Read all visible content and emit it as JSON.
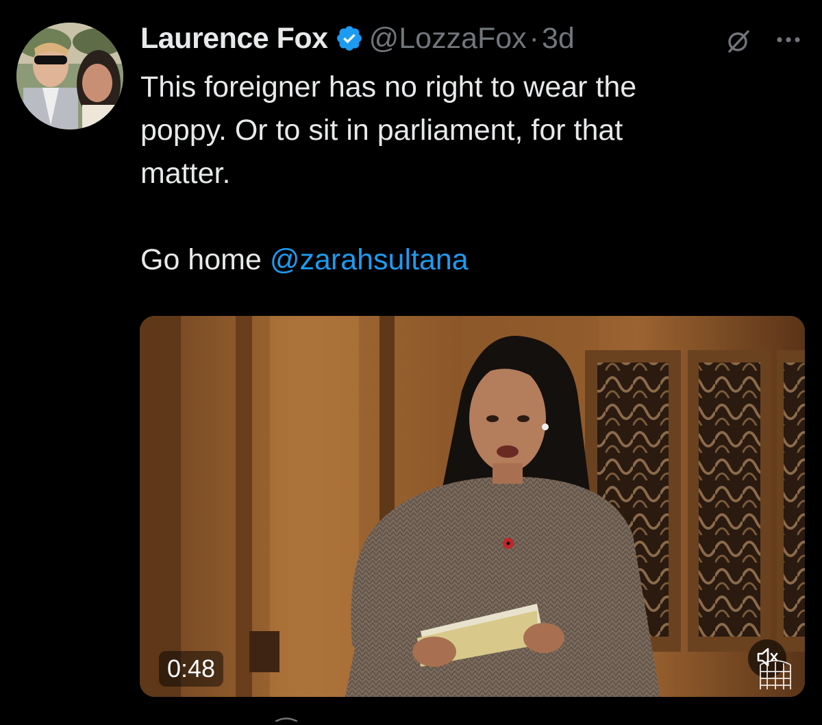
{
  "tweet": {
    "author": {
      "name": "Laurence Fox",
      "handle": "@LozzaFox",
      "verified": true,
      "avatar_icon": "profile-photo"
    },
    "separator": "·",
    "time": "3d",
    "text_lines": [
      "This foreigner has no right to wear the",
      "poppy. Or to sit in parliament, for that",
      "matter."
    ],
    "closing_text": "Go home",
    "mention": "@zarahsultana",
    "video": {
      "duration": "0:48",
      "muted": true,
      "mute_icon": "speaker-muted-icon",
      "watermark_icon": "portcullis-icon"
    },
    "icons": {
      "grok": "grok-icon",
      "more": "more-options-icon",
      "verified": "verified-badge-icon"
    }
  },
  "colors": {
    "background": "#000000",
    "text": "#e7e9ea",
    "secondary": "#71767b",
    "accent": "#1d9bf0"
  }
}
